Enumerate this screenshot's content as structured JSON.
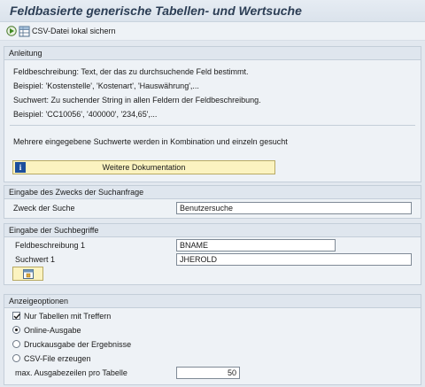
{
  "header": {
    "title": "Feldbasierte generische Tabellen- und Wertsuche"
  },
  "toolbar": {
    "csv_label": "CSV-Datei lokal sichern"
  },
  "anleitung": {
    "heading": "Anleitung",
    "lines": [
      "Feldbeschreibung: Text, der das zu durchsuchende Feld bestimmt.",
      "Beispiel: 'Kostenstelle', 'Kostenart', 'Hauswährung',...",
      "Suchwert: Zu suchender String in allen Feldern der Feldbeschreibung.",
      "Beispiel: 'CC10056', '400000', '234,65',..."
    ],
    "note": "Mehrere eingegebene Suchwerte werden in Kombination und einzeln gesucht",
    "doc_button": "Weitere Dokumentation"
  },
  "zweck": {
    "heading": "Eingabe des Zwecks der Suchanfrage",
    "label": "Zweck der Suche",
    "value": "Benutzersuche"
  },
  "suchbegriffe": {
    "heading": "Eingabe der Suchbegriffe",
    "field1_label": "Feldbeschreibung 1",
    "field1_value": "BNAME",
    "search1_label": "Suchwert 1",
    "search1_value": "JHEROLD"
  },
  "anzeige": {
    "heading": "Anzeigeoptionen",
    "only_hits_label": "Nur Tabellen mit Treffern",
    "only_hits_checked": true,
    "options": [
      "Online-Ausgabe",
      "Druckausgabe der Ergebnisse",
      "CSV-File erzeugen"
    ],
    "selected_option": 0,
    "max_rows_label": "max. Ausgabezeilen pro Tabelle",
    "max_rows_value": "50"
  }
}
